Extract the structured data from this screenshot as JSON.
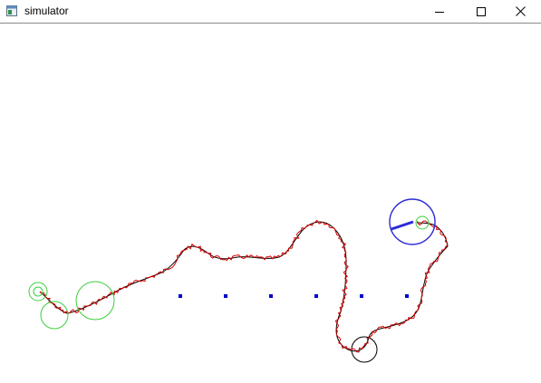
{
  "window": {
    "title": "simulator",
    "icons": {
      "app": "app-window-icon",
      "minimize": "minimize-icon",
      "maximize": "maximize-icon",
      "close": "close-icon"
    }
  },
  "colors": {
    "reference_path": "#000000",
    "robot_trail": "#d40000",
    "waypoints": "#0000cc",
    "robot_body": "#2b2bd6",
    "lookahead_circles": "#3ccf3c"
  }
}
